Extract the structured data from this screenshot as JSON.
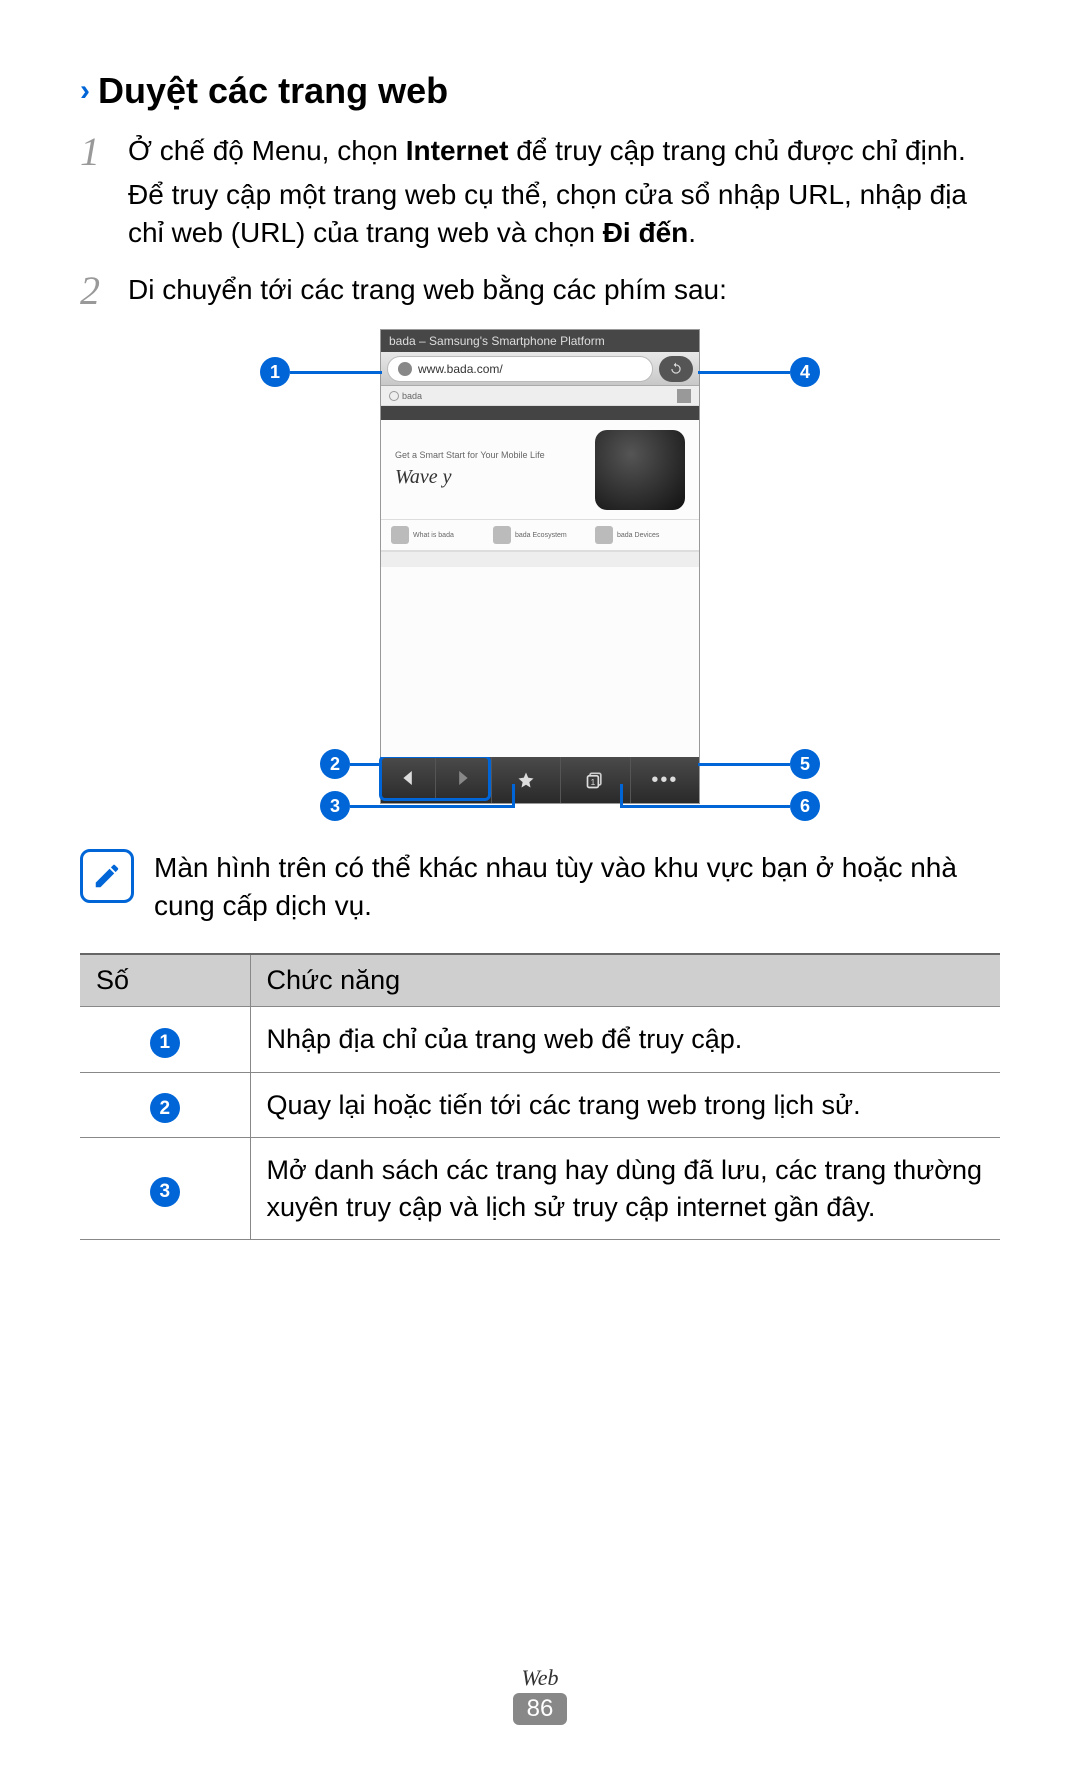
{
  "section_title": "Duyệt các trang web",
  "steps": [
    {
      "num": "1",
      "lines": [
        {
          "segments": [
            {
              "t": "Ở chế độ Menu, chọn "
            },
            {
              "t": "Internet",
              "bold": true
            },
            {
              "t": " để truy cập trang chủ được chỉ định."
            }
          ]
        },
        {
          "segments": [
            {
              "t": "Để truy cập một trang web cụ thể, chọn cửa sổ nhập URL, nhập địa chỉ web (URL) của trang web và chọn "
            },
            {
              "t": "Đi đến",
              "bold": true
            },
            {
              "t": "."
            }
          ]
        }
      ]
    },
    {
      "num": "2",
      "lines": [
        {
          "segments": [
            {
              "t": "Di chuyển tới các trang web bằng các phím sau:"
            }
          ]
        }
      ]
    }
  ],
  "mock": {
    "title_bar": "bada – Samsung's Smartphone Platform",
    "url": "www.bada.com/",
    "brand": "bada",
    "hero_caption": "Get a Smart Start for Your Mobile Life",
    "wave_logo": "Wave y",
    "callouts": [
      "1",
      "2",
      "3",
      "4",
      "5",
      "6"
    ]
  },
  "note": "Màn hình trên có thể khác nhau tùy vào khu vực bạn ở hoặc nhà cung cấp dịch vụ.",
  "table": {
    "headers": [
      "Số",
      "Chức năng"
    ],
    "rows": [
      {
        "n": "1",
        "f": "Nhập địa chỉ của trang web để truy cập."
      },
      {
        "n": "2",
        "f": "Quay lại hoặc tiến tới các trang web trong lịch sử."
      },
      {
        "n": "3",
        "f": "Mở danh sách các trang hay dùng đã lưu, các trang thường xuyên truy cập và lịch sử truy cập internet gần đây."
      }
    ]
  },
  "footer": {
    "category": "Web",
    "page": "86"
  }
}
